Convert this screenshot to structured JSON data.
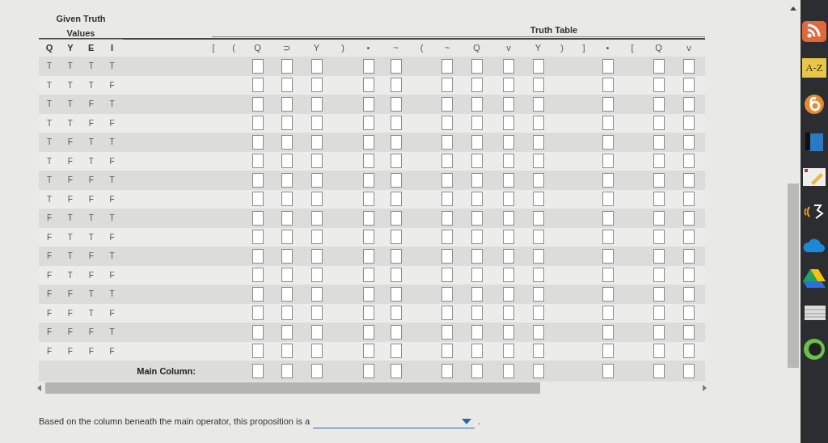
{
  "given_title": "Given Truth Values",
  "table_title": "Truth Table",
  "given_columns": [
    "Q",
    "Y",
    "E",
    "I"
  ],
  "formula_columns": [
    {
      "symbol": "[",
      "kind": "bracket"
    },
    {
      "symbol": "(",
      "kind": "bracket"
    },
    {
      "symbol": "Q",
      "kind": "answer"
    },
    {
      "symbol": "⊃",
      "kind": "answer"
    },
    {
      "symbol": "Y",
      "kind": "answer"
    },
    {
      "symbol": ")",
      "kind": "bracket"
    },
    {
      "symbol": "•",
      "kind": "answer"
    },
    {
      "symbol": "~",
      "kind": "answer"
    },
    {
      "symbol": "(",
      "kind": "bracket"
    },
    {
      "symbol": "~",
      "kind": "answer"
    },
    {
      "symbol": "Q",
      "kind": "answer"
    },
    {
      "symbol": "v",
      "kind": "answer"
    },
    {
      "symbol": "Y",
      "kind": "answer"
    },
    {
      "symbol": ")",
      "kind": "bracket"
    },
    {
      "symbol": "]",
      "kind": "bracket"
    },
    {
      "symbol": "•",
      "kind": "answer"
    },
    {
      "symbol": "[",
      "kind": "bracket"
    },
    {
      "symbol": "Q",
      "kind": "answer"
    },
    {
      "symbol": "v",
      "kind": "answer"
    }
  ],
  "rows": [
    [
      "T",
      "T",
      "T",
      "T"
    ],
    [
      "T",
      "T",
      "T",
      "F"
    ],
    [
      "T",
      "T",
      "F",
      "T"
    ],
    [
      "T",
      "T",
      "F",
      "F"
    ],
    [
      "T",
      "F",
      "T",
      "T"
    ],
    [
      "T",
      "F",
      "T",
      "F"
    ],
    [
      "T",
      "F",
      "F",
      "T"
    ],
    [
      "T",
      "F",
      "F",
      "F"
    ],
    [
      "F",
      "T",
      "T",
      "T"
    ],
    [
      "F",
      "T",
      "T",
      "F"
    ],
    [
      "F",
      "T",
      "F",
      "T"
    ],
    [
      "F",
      "T",
      "F",
      "F"
    ],
    [
      "F",
      "F",
      "T",
      "T"
    ],
    [
      "F",
      "F",
      "T",
      "F"
    ],
    [
      "F",
      "F",
      "F",
      "T"
    ],
    [
      "F",
      "F",
      "F",
      "F"
    ]
  ],
  "main_column_label": "Main Column:",
  "answer": {
    "prompt": "Based on the column beneath the main operator, this proposition is a",
    "suffix": "."
  },
  "taskbar": [
    {
      "kind": "rss"
    },
    {
      "kind": "text",
      "label": "A-Z"
    },
    {
      "kind": "ring"
    },
    {
      "kind": "book"
    },
    {
      "kind": "note"
    },
    {
      "kind": "wave"
    },
    {
      "kind": "cloud"
    },
    {
      "kind": "drive"
    },
    {
      "kind": "stack"
    },
    {
      "kind": "avatar"
    }
  ]
}
